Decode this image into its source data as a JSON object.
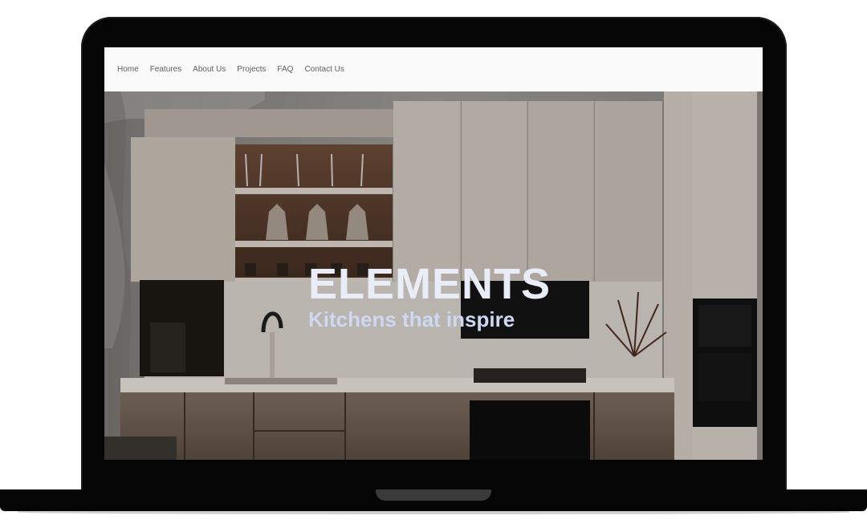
{
  "nav": {
    "items": [
      {
        "label": "Home"
      },
      {
        "label": "Features"
      },
      {
        "label": "About Us"
      },
      {
        "label": "Projects"
      },
      {
        "label": "FAQ"
      },
      {
        "label": "Contact Us"
      }
    ]
  },
  "hero": {
    "title": "ELEMENTS",
    "subtitle": "Kitchens that inspire",
    "image_icon": "kitchen-photo"
  },
  "colors": {
    "nav_background": "#fafafa",
    "nav_text": "#5e5e5e",
    "title": "#e9edf7",
    "subtitle": "#cfd8f2",
    "device": "#050505"
  }
}
